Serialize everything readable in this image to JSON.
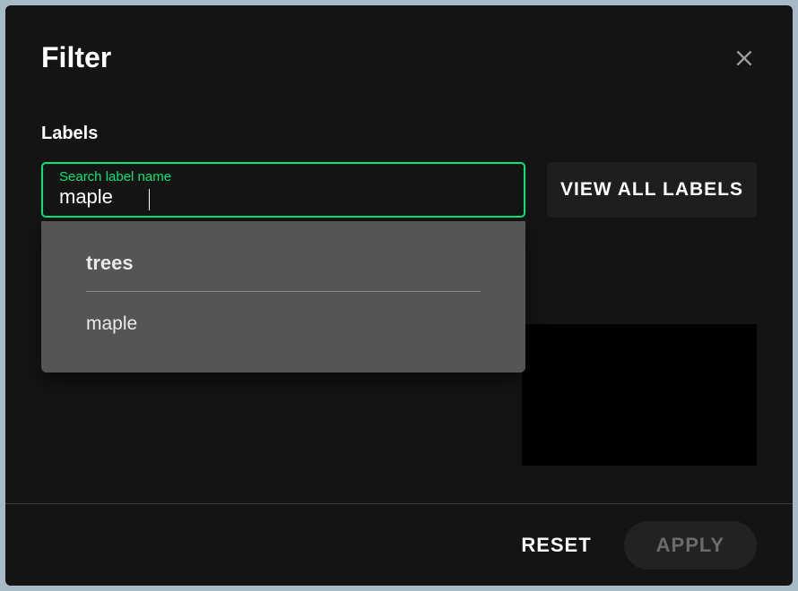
{
  "dialog": {
    "title": "Filter",
    "section_label": "Labels",
    "search": {
      "float_label": "Search label name",
      "value": "maple"
    },
    "view_all_label": "VIEW ALL LABELS",
    "dropdown": {
      "group": "trees",
      "items": [
        "maple"
      ]
    },
    "footer": {
      "reset_label": "RESET",
      "apply_label": "APPLY"
    }
  }
}
